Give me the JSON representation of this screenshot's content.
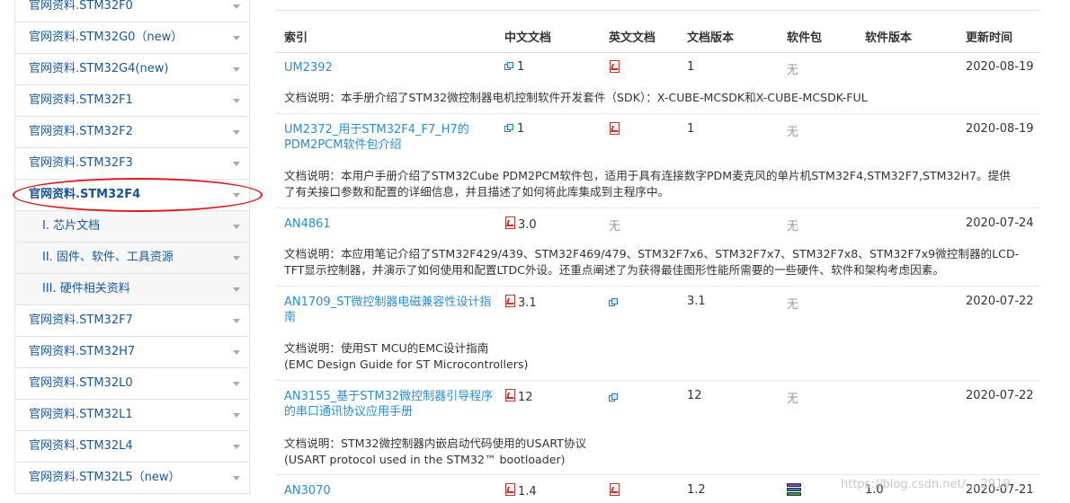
{
  "sidebar": {
    "items": [
      {
        "label": "官网资料.STM32F0"
      },
      {
        "label": "官网资料.STM32G0（new）"
      },
      {
        "label": "官网资料.STM32G4(new)"
      },
      {
        "label": "官网资料.STM32F1"
      },
      {
        "label": "官网资料.STM32F2"
      },
      {
        "label": "官网资料.STM32F3"
      },
      {
        "label": "官网资料.STM32F4"
      },
      {
        "label": "I. 芯片文档"
      },
      {
        "label": "II. 固件、软件、工具资源"
      },
      {
        "label": "III. 硬件相关资料"
      },
      {
        "label": "官网资料.STM32F7"
      },
      {
        "label": "官网资料.STM32H7"
      },
      {
        "label": "官网资料.STM32L0"
      },
      {
        "label": "官网资料.STM32L1"
      },
      {
        "label": "官网资料.STM32L4"
      },
      {
        "label": "官网资料.STM32L5（new）"
      }
    ],
    "active_label": "官网资料.STM32F4",
    "highlight_color": "#e1191e"
  },
  "table": {
    "headers": {
      "index": "索引",
      "cn_doc": "中文文档",
      "en_doc": "英文文档",
      "doc_version": "文档版本",
      "package": "软件包",
      "sw_version": "软件版本",
      "updated": "更新时间"
    },
    "rows": [
      {
        "index": "UM2392",
        "cn_version": "1",
        "doc_version": "1",
        "package": "无",
        "sw_version": "",
        "updated": "2020-08-19",
        "desc_line1": "文档说明：本手册介绍了STM32微控制器电机控制软件开发套件（SDK）：X-CUBE-MCSDK和X-CUBE-MCSDK-FUL",
        "desc_line2": ""
      },
      {
        "index": "UM2372_用于STM32F4_F7_H7的PDM2PCM软件包介绍",
        "cn_version": "1",
        "doc_version": "1",
        "package": "无",
        "sw_version": "",
        "updated": "2020-08-19",
        "desc_line1": "文档说明：本用户手册介绍了STM32Cube PDM2PCM软件包，适用于具有连接数字PDM麦克风的单片机STM32F4,STM32F7,STM32H7。提供",
        "desc_line2": "了有关接口参数和配置的详细信息，并且描述了如何将此库集成到主程序中。"
      },
      {
        "index": "AN4861",
        "cn_version": "3.0",
        "en_doc": "无",
        "doc_version": "",
        "package": "无",
        "sw_version": "",
        "updated": "2020-07-24",
        "desc_line1": "文档说明：本应用笔记介绍了STM32F429/439、STM32F469/479、STM32F7x6、STM32F7x7、STM32F7x8、STM32F7x9微控制器的LCD-",
        "desc_line2": "TFT显示控制器，并演示了如何使用和配置LTDC外设。还重点阐述了为获得最佳图形性能所需要的一些硬件、软件和架构考虑因素。"
      },
      {
        "index": "AN1709_ST微控制器电磁兼容性设计指南",
        "cn_version": "3.1",
        "doc_version": "3.1",
        "package": "无",
        "sw_version": "",
        "updated": "2020-07-22",
        "desc_line1": "文档说明：使用ST MCU的EMC设计指南",
        "desc_line2": "(EMC Design Guide for ST Microcontrollers)"
      },
      {
        "index": "AN3155_基于STM32微控制器引导程序的串口通讯协议应用手册",
        "cn_version": "12",
        "doc_version": "12",
        "package": "无",
        "sw_version": "",
        "updated": "2020-07-22",
        "desc_line1": "文档说明：STM32微控制器内嵌启动代码使用的USART协议",
        "desc_line2": "(USART protocol used in the STM32™ bootloader)"
      },
      {
        "index": "AN3070",
        "cn_version": "1.4",
        "doc_version": "1.2",
        "package": "",
        "sw_version": "1.0",
        "updated": "2020-07-21",
        "desc_line1": "",
        "desc_line2": ""
      }
    ]
  },
  "watermark": "https://blog.csdn.net/... 2919"
}
